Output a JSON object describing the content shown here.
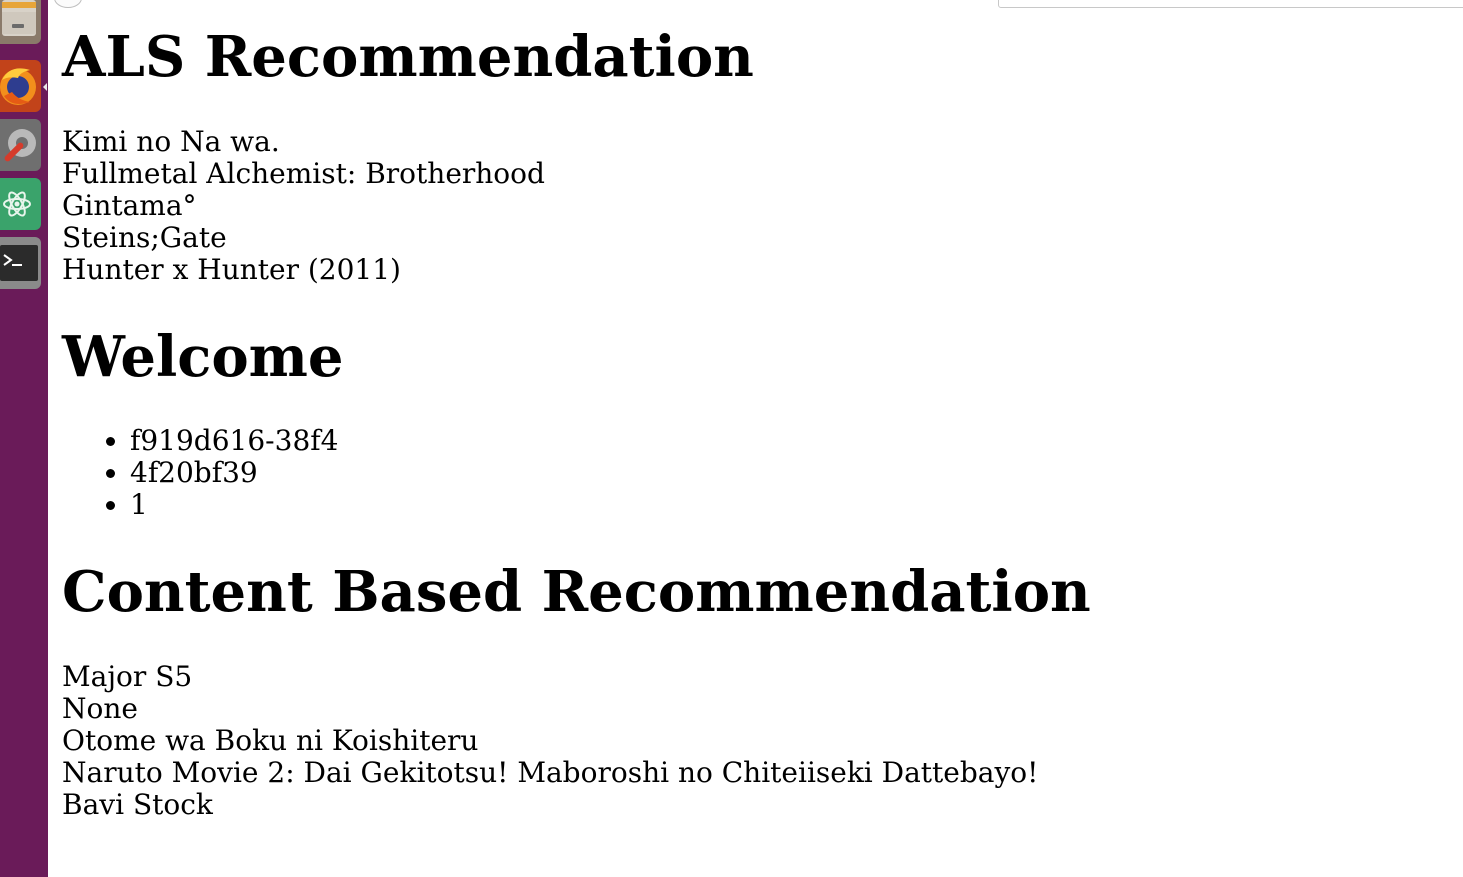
{
  "launcher": {
    "icons": [
      "files-icon",
      "firefox-icon",
      "system-settings-icon",
      "atom-icon",
      "terminal-icon"
    ]
  },
  "page": {
    "als_title": "ALS Recommendation",
    "als_items": [
      "Kimi no Na wa.",
      "Fullmetal Alchemist: Brotherhood",
      "Gintama°",
      "Steins;Gate",
      "Hunter x Hunter (2011)"
    ],
    "welcome_title": "Welcome",
    "welcome_items": [
      "f919d616-38f4",
      "4f20bf39",
      "1"
    ],
    "content_title": "Content Based Recommendation",
    "content_items": [
      "Major S5",
      "None",
      "Otome wa Boku ni Koishiteru",
      "Naruto Movie 2: Dai Gekitotsu! Maboroshi no Chiteiiseki Dattebayo!",
      "Bavi Stock"
    ]
  },
  "colors": {
    "launcher_bg": "#6a1b59",
    "page_bg": "#ffffff",
    "text": "#000000"
  }
}
